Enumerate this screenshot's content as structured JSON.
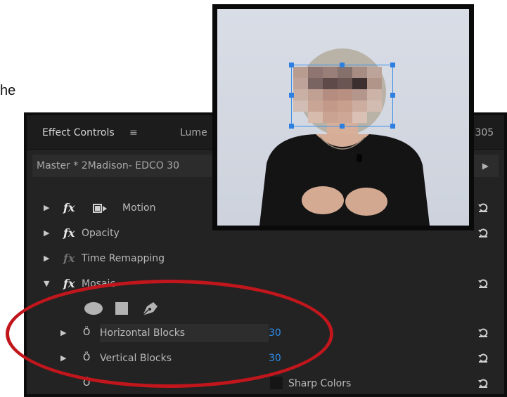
{
  "stray_text": "he",
  "tabs": {
    "effect_controls": "Effect Controls",
    "menu_glyph": "≡",
    "lumetri_partial": "Lume",
    "right_partial": "O 305"
  },
  "clip": {
    "name": "Master * 2Madison- EDCO 30",
    "arrow": "▶"
  },
  "effects": [
    {
      "label": "Motion"
    },
    {
      "label": "Opacity"
    },
    {
      "label": "Time Remapping"
    },
    {
      "label": "Mosaic"
    }
  ],
  "mosaic": {
    "horizontal_label": "Horizontal Blocks",
    "horizontal_value": "30",
    "vertical_label": "Vertical Blocks",
    "vertical_value": "30",
    "sharp_colors_label": "Sharp Colors"
  },
  "icons": {
    "expand": "▶",
    "expanded": "▼",
    "fx": "fx",
    "stopwatch": "Ö"
  },
  "colors": {
    "panel_bg": "#232323",
    "value_blue": "#2d8ceb",
    "annotation_red": "#c0161c",
    "selection_blue": "#3b8fe6"
  }
}
